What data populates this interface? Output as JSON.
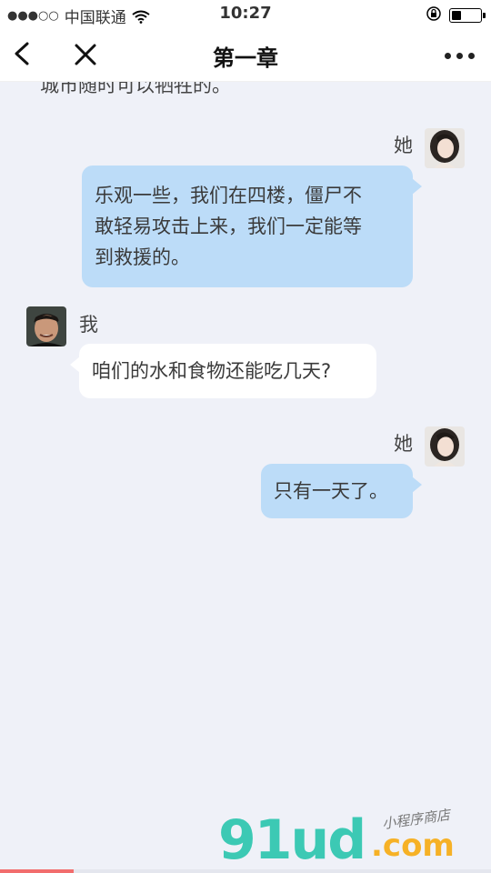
{
  "status_bar": {
    "signal": "●●●○○",
    "carrier": "中国联通",
    "time": "10:27"
  },
  "nav": {
    "title": "第一章"
  },
  "chat": {
    "partial_text": "城市随时可以牺牲的。",
    "messages": [
      {
        "sender": "她",
        "side": "right",
        "text_lines": [
          "乐观一些，我们在四楼，僵尸不",
          "敢轻易攻击上来，我们一定能等",
          "到救援的。"
        ]
      },
      {
        "sender": "我",
        "side": "left",
        "text_lines": [
          "咱们的水和食物还能吃几天?"
        ]
      },
      {
        "sender": "她",
        "side": "right",
        "text_lines": [
          "只有一天了。"
        ]
      }
    ]
  },
  "watermark": {
    "brand": "91ud",
    "domain": ".com",
    "tagline": "小程序商店"
  },
  "reading_progress": 0.15,
  "colors": {
    "background": "#eff1f8",
    "bubble_right": "#bcdcf8",
    "bubble_left": "#ffffff",
    "progress": "#f26d6d",
    "watermark_green": "#3cc9b4",
    "watermark_orange": "#f6b126"
  }
}
